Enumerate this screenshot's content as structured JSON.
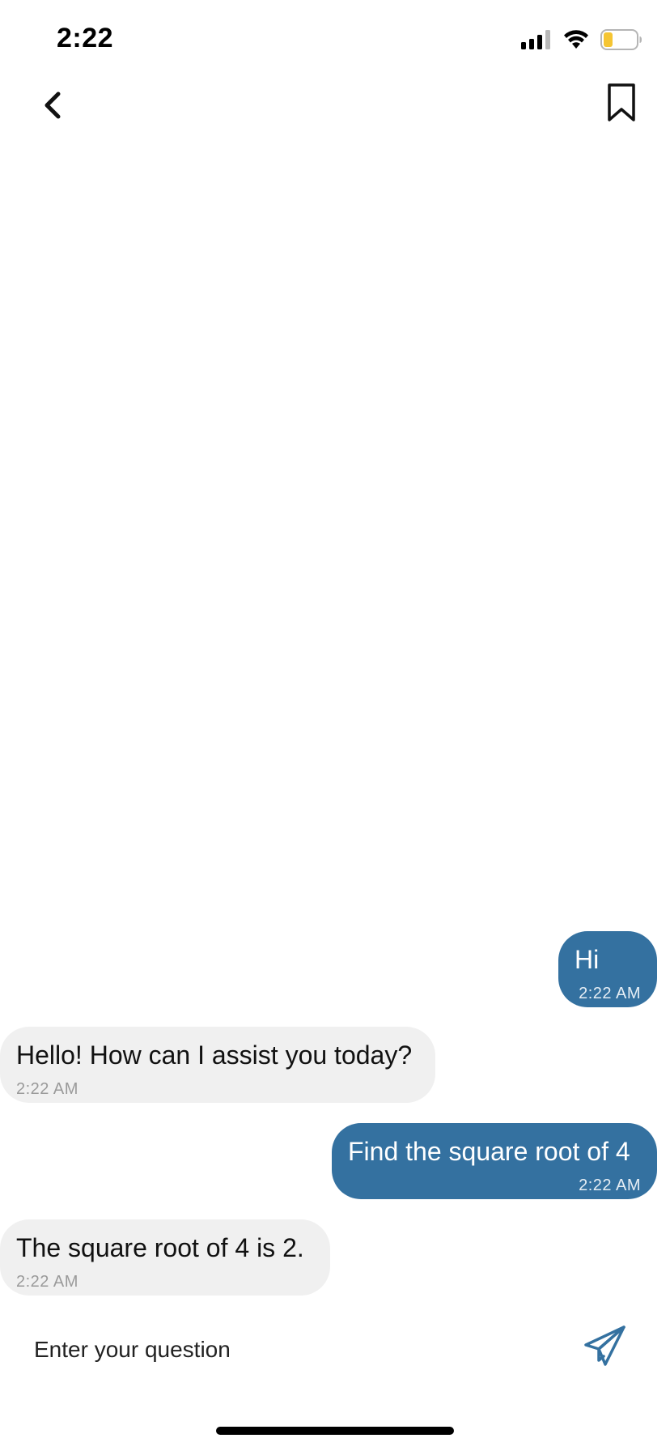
{
  "status": {
    "time": "2:22"
  },
  "icons": {
    "signal": "cellular-signal-icon",
    "wifi": "wifi-icon",
    "battery": "battery-icon",
    "back": "chevron-left-icon",
    "bookmark": "bookmark-icon",
    "send": "send-paper-plane-icon"
  },
  "colors": {
    "user_bubble": "#3471a0",
    "bot_bubble": "#f0f0f0",
    "battery_level": "#f5c533"
  },
  "messages": [
    {
      "sender": "user",
      "text": "Hi",
      "time": "2:22 AM"
    },
    {
      "sender": "bot",
      "text": "Hello! How can I assist you today?",
      "time": "2:22 AM"
    },
    {
      "sender": "user",
      "text": "Find the square root of 4",
      "time": "2:22 AM"
    },
    {
      "sender": "bot",
      "text": "The square root of 4 is 2.",
      "time": "2:22 AM"
    }
  ],
  "input": {
    "placeholder": "Enter your question",
    "value": ""
  }
}
